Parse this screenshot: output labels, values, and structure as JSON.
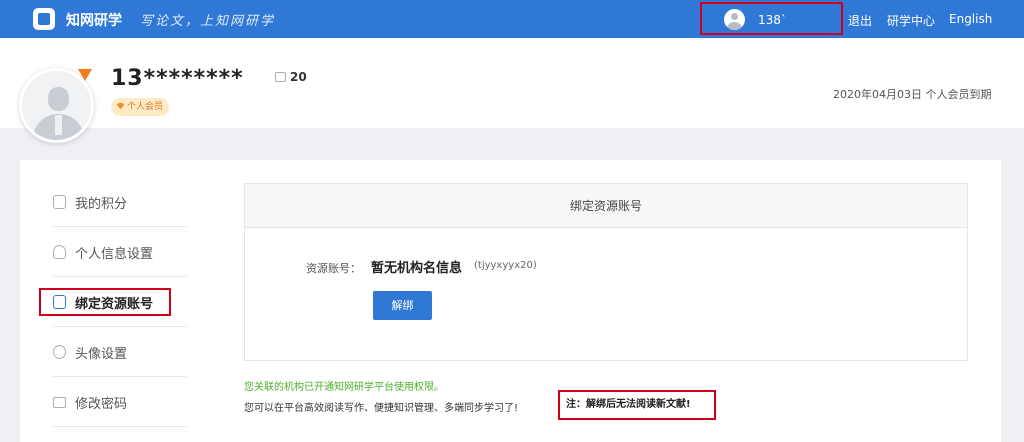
{
  "header": {
    "brand": "知网研学",
    "slogan": "写论文，上知网研学",
    "user_phone": "138`",
    "links": [
      "退出",
      "研学中心",
      "English"
    ]
  },
  "profile": {
    "username": "13********",
    "points": "20",
    "member_tag": "个人会员",
    "expiry": "2020年04月03日 个人会员到期"
  },
  "sidebar": {
    "items": [
      {
        "label": "我的积分",
        "icon": "points-icon"
      },
      {
        "label": "个人信息设置",
        "icon": "user-icon"
      },
      {
        "label": "绑定资源账号",
        "icon": "document-icon",
        "active": true
      },
      {
        "label": "头像设置",
        "icon": "avatar-icon"
      },
      {
        "label": "修改密码",
        "icon": "lock-icon"
      }
    ]
  },
  "bind": {
    "title": "绑定资源账号",
    "account_label": "资源账号：",
    "account_value": "暂无机构名信息",
    "account_id": "(tjyyxyyx20)",
    "unbind_label": "解绑",
    "notice_green": "您关联的机构已开通知网研学平台使用权限。",
    "notice_tip": "您可以在平台高效阅读写作、便捷知识管理、多端同步学习了!",
    "notice_warn": "注：解绑后无法阅读新文献!"
  },
  "colors": {
    "primary": "#2f78d6",
    "highlight": "#d0001b",
    "success": "#4caf2c",
    "vip": "#f27b1d"
  }
}
